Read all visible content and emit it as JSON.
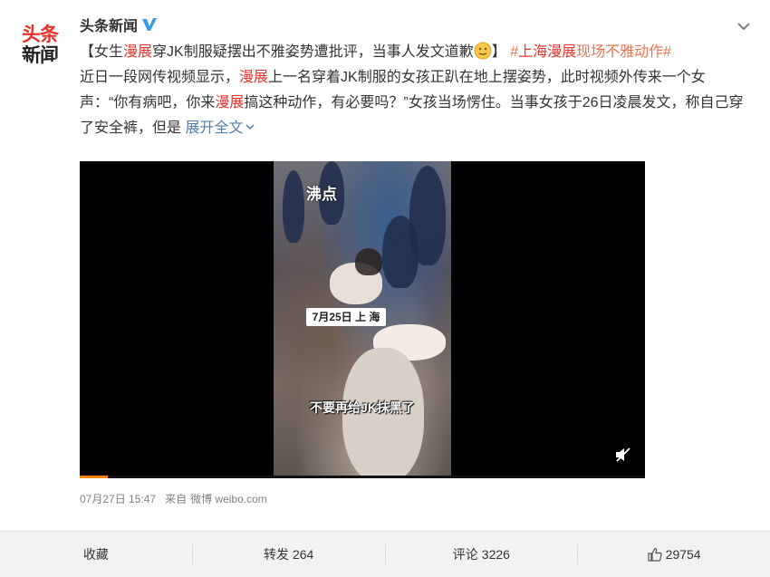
{
  "author": {
    "avatar_text_top": "头条",
    "avatar_text_bottom": "新闻",
    "name": "头条新闻",
    "verified_icon": "verified-v-icon"
  },
  "header": {
    "menu_icon": "chevron-down-icon"
  },
  "post": {
    "line1_a": "【女生",
    "line1_hl": "漫展",
    "line1_b": "穿JK制服疑摆出不雅姿势遭批评，当事人发文道歉",
    "emoji": "sweat-smile-emoji-icon",
    "line1_c": "】",
    "topic_prefix": "#",
    "topic_red": "上海漫展",
    "topic_rest": "现场不雅动作#",
    "p2_a": "近日一段网传视频显示，",
    "p2_hl": "漫展",
    "p2_b": "上一名穿着JK制服的女孩正趴在地上摆姿势，此时视频外传来一个女声：“你有病吧，你来",
    "p2_hl2": "漫展",
    "p2_c": "搞这种动作，有必要吗？”女孩当场愣住。当事女孩于26日凌晨发文，称自己穿了安全裤，但是 ",
    "expand_label": "展开全文"
  },
  "video": {
    "watermark": "沸点",
    "date_tag": "7月25日 上 海",
    "subtitle": "不要再给JK抹黑了",
    "mute_icon": "volume-mute-icon",
    "progress": 0.05,
    "progress_color": "#ff8200"
  },
  "meta": {
    "time": "07月27日 15:47",
    "source_prefix": "来自",
    "source": "微博 weibo.com"
  },
  "footer": {
    "favorite_label": "收藏",
    "repost_label": "转发",
    "repost_count": "264",
    "comment_label": "评论",
    "comment_count": "3226",
    "like_icon": "thumbs-up-icon",
    "like_count": "29754"
  },
  "colors": {
    "highlight_red": "#e8322d",
    "topic_orange": "#eb7350",
    "link_blue": "#507daf"
  }
}
